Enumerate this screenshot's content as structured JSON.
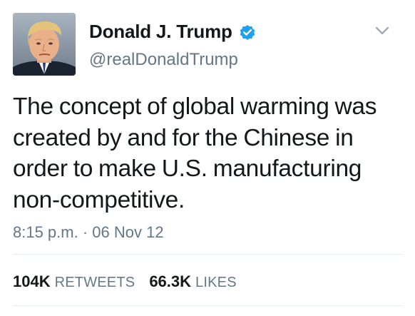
{
  "user": {
    "display_name": "Donald J. Trump",
    "handle": "@realDonaldTrump",
    "verified_icon": "verified-badge-icon",
    "avatar_icon": "profile-avatar"
  },
  "tweet": {
    "text": "The concept of global warming was created by and for the Chinese in order to make U.S. manufacturing non-competitive.",
    "timestamp": "8:15 p.m. · 06 Nov 12"
  },
  "stats": {
    "retweets_count": "104K",
    "retweets_label": "RETWEETS",
    "likes_count": "66.3K",
    "likes_label": "LIKES"
  },
  "colors": {
    "verified_blue": "#1da1f2",
    "secondary_text": "#657786",
    "primary_text": "#14171a",
    "divider": "#e6ecf0"
  }
}
